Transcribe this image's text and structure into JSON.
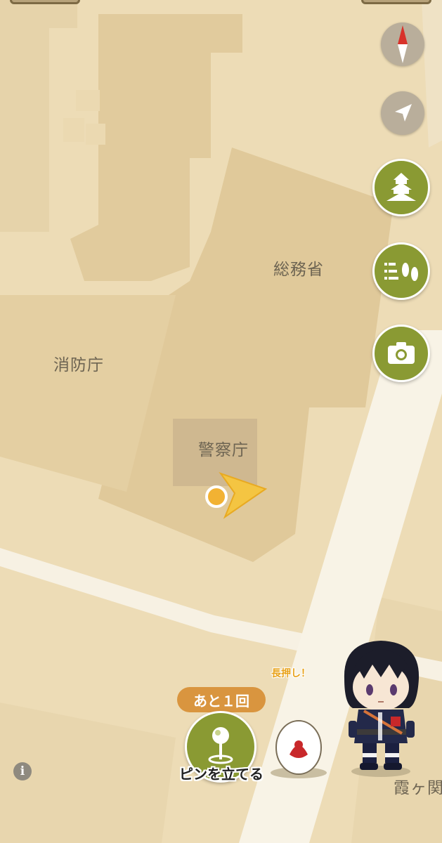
{
  "map": {
    "labels": {
      "soumusho": "総務省",
      "shouboucho": "消防庁",
      "keisatsucho": "警察庁",
      "kasumigaseki": "霞ヶ関"
    }
  },
  "controls": {
    "compass_icon": "compass-icon",
    "locate_icon": "location-arrow-icon",
    "castle_icon": "castle-icon",
    "footprints_icon": "footprints-icon",
    "camera_icon": "camera-icon"
  },
  "pin": {
    "remaining": "あと１回",
    "label": "ピンを立てる"
  },
  "companion": {
    "hint": "長押し！"
  },
  "info_label": "i",
  "colors": {
    "ground": "#eddcb6",
    "building": "#e3cfa5",
    "road": "#f7f1e3",
    "accent_green": "#8a9a33",
    "badge_orange": "#d9953f",
    "player_yellow": "#f4c542"
  }
}
